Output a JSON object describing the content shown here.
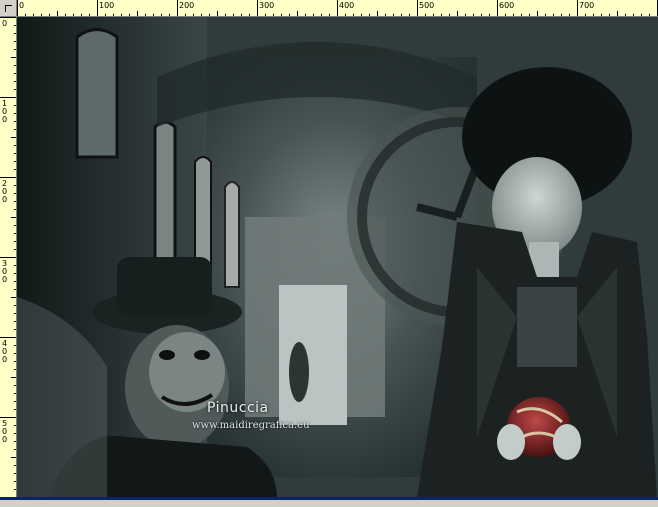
{
  "rulers": {
    "top_labels": [
      "0",
      "100",
      "200",
      "300",
      "400",
      "500",
      "600",
      "700"
    ],
    "left_labels": [
      "0",
      "100",
      "200",
      "300",
      "400",
      "500"
    ]
  },
  "image": {
    "signature": "Pinuccia",
    "website": "www.maidiregrafica.eu"
  },
  "colors": {
    "ruler_bg": "#ffffc8",
    "canvas_bg": "#2f3c3b",
    "selection_bar": "#0a246a"
  }
}
